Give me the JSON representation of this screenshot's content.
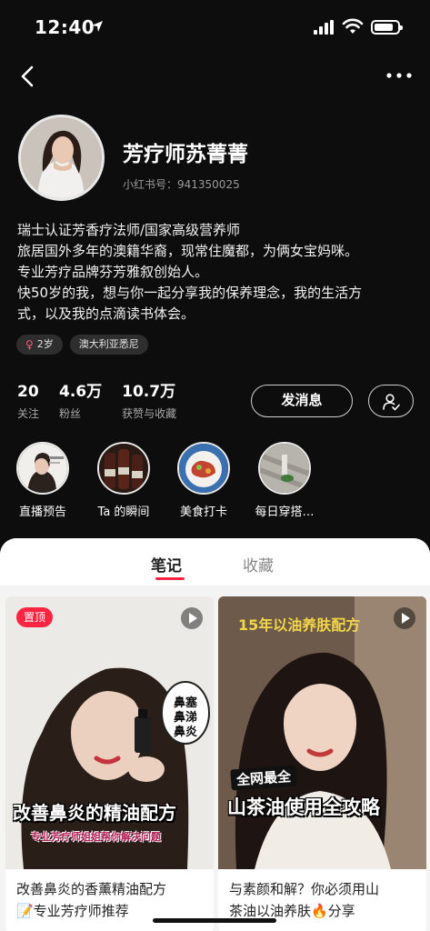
{
  "status": {
    "time": "12:40"
  },
  "profile": {
    "name": "芳疗师苏菁菁",
    "red_id": "小红书号：941350025",
    "bio": [
      "瑞士认证芳香疗法师/国家高级营养师",
      "旅居国外多年的澳籍华裔，现常住魔都，为俩女宝妈咪。",
      "专业芳疗品牌芬芳雅叙创始人。",
      "快50岁的我，想与你一起分享我的保养理念，我的生活方",
      "式，以及我的点滴读书体会。"
    ],
    "tags": {
      "age": "2岁",
      "location": "澳大利亚悉尼"
    },
    "stats": [
      {
        "value": "20",
        "label": "关注"
      },
      {
        "value": "4.6万",
        "label": "粉丝"
      },
      {
        "value": "10.7万",
        "label": "获赞与收藏"
      }
    ],
    "message_button": "发消息"
  },
  "highlights": [
    {
      "label": "直播预告"
    },
    {
      "label": "Ta 的瞬间"
    },
    {
      "label": "美食打卡"
    },
    {
      "label": "每日穿搭…"
    }
  ],
  "tabs": {
    "notes": "笔记",
    "collections": "收藏"
  },
  "cards": [
    {
      "pinned_label": "置顶",
      "overlay_main": "改善鼻炎的精油配方",
      "overlay_sub": "专业芳疗师姐姐帮你解决问题",
      "bubble": [
        "鼻塞",
        "鼻涕",
        "鼻炎"
      ],
      "title": [
        "改善鼻炎的香薰精油配方",
        "📝专业芳疗师推荐"
      ]
    },
    {
      "overlay_top": "15年以油养肤配方",
      "overlay_badge": "全网最全",
      "overlay_main": "山茶油使用全攻略",
      "title": [
        "与素颜和解？你必须用山",
        "茶油以油养肤🔥分享"
      ]
    }
  ],
  "colors": {
    "accent": "#ff2442",
    "background": "#0d0d0d",
    "panel": "#f4f4f4"
  }
}
